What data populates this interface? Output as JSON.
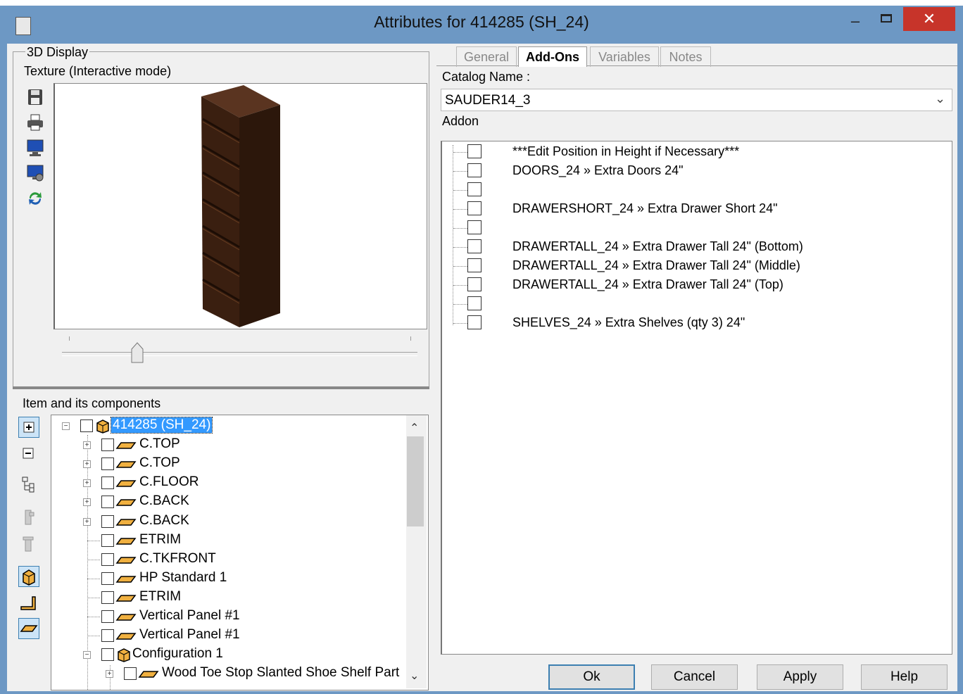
{
  "window": {
    "title": "Attributes for 414285 (SH_24)",
    "minimize_label": "–",
    "close_label": "✕"
  },
  "display_group": {
    "label": "3D Display",
    "texture_label": "Texture (Interactive mode)",
    "tools": [
      "save-icon",
      "print-icon",
      "monitor-icon",
      "monitor-settings-icon",
      "refresh-icon"
    ]
  },
  "items_group": {
    "label": "Item and its components",
    "tools": [
      "expand-all-icon",
      "collapse-all-icon",
      "tree-view-icon",
      "part-disabled-icon",
      "part-disabled-icon",
      "cube-icon",
      "angle-icon",
      "panel-icon"
    ],
    "tree": [
      {
        "label": "414285 (SH_24)",
        "level": 0,
        "expander": "−",
        "icon": "cube",
        "selected": true
      },
      {
        "label": "C.TOP",
        "level": 1,
        "expander": "+",
        "icon": "panel"
      },
      {
        "label": "C.TOP",
        "level": 1,
        "expander": "+",
        "icon": "panel"
      },
      {
        "label": "C.FLOOR",
        "level": 1,
        "expander": "+",
        "icon": "panel"
      },
      {
        "label": "C.BACK",
        "level": 1,
        "expander": "+",
        "icon": "panel"
      },
      {
        "label": "C.BACK",
        "level": 1,
        "expander": "+",
        "icon": "panel"
      },
      {
        "label": "ETRIM",
        "level": 1,
        "expander": "",
        "icon": "panel"
      },
      {
        "label": "C.TKFRONT",
        "level": 1,
        "expander": "",
        "icon": "panel"
      },
      {
        "label": "HP Standard 1",
        "level": 1,
        "expander": "",
        "icon": "panel"
      },
      {
        "label": "ETRIM",
        "level": 1,
        "expander": "",
        "icon": "panel"
      },
      {
        "label": "Vertical Panel #1",
        "level": 1,
        "expander": "",
        "icon": "panel"
      },
      {
        "label": "Vertical Panel #1",
        "level": 1,
        "expander": "",
        "icon": "panel"
      },
      {
        "label": "Configuration 1",
        "level": 1,
        "expander": "−",
        "icon": "cube"
      },
      {
        "label": "Wood Toe Stop Slanted Shoe Shelf Part",
        "level": 2,
        "expander": "+",
        "icon": "panel"
      }
    ]
  },
  "tabs": [
    {
      "label": "General",
      "active": false
    },
    {
      "label": "Add-Ons",
      "active": true
    },
    {
      "label": "Variables",
      "active": false
    },
    {
      "label": "Notes",
      "active": false
    }
  ],
  "addons": {
    "catalog_label": "Catalog Name :",
    "catalog_value": "SAUDER14_3",
    "addon_label": "Addon",
    "items": [
      {
        "text": "***Edit Position in Height if Necessary***",
        "checked": false
      },
      {
        "text": "DOORS_24 » Extra Doors 24\"",
        "checked": false
      },
      {
        "text": "",
        "checked": false
      },
      {
        "text": "DRAWERSHORT_24 » Extra Drawer Short 24\"",
        "checked": false
      },
      {
        "text": "",
        "checked": false
      },
      {
        "text": "DRAWERTALL_24 » Extra Drawer Tall 24\" (Bottom)",
        "checked": false
      },
      {
        "text": "DRAWERTALL_24 » Extra Drawer Tall 24\" (Middle)",
        "checked": false
      },
      {
        "text": "DRAWERTALL_24 » Extra Drawer Tall 24\" (Top)",
        "checked": false
      },
      {
        "text": "",
        "checked": false
      },
      {
        "text": "SHELVES_24 » Extra Shelves (qty 3) 24\"",
        "checked": false
      }
    ]
  },
  "buttons": {
    "ok": "Ok",
    "cancel": "Cancel",
    "apply": "Apply",
    "help": "Help"
  },
  "colors": {
    "titlebar": "#6d98c4",
    "close": "#c7342a",
    "selection": "#3399ff",
    "cabinet": "#3a1f10"
  }
}
